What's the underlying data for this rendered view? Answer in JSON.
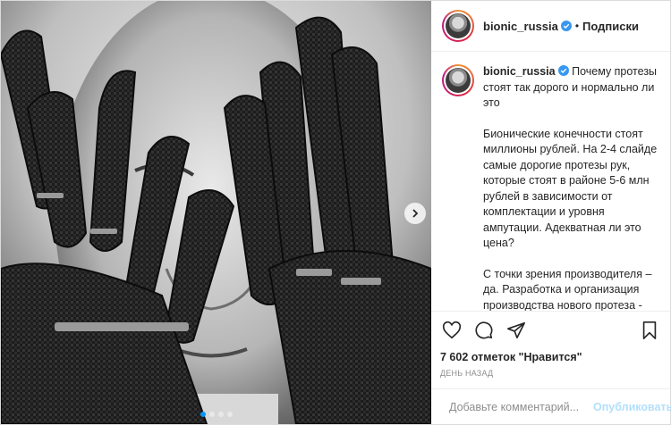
{
  "account": {
    "username": "bionic_russia",
    "verified": true,
    "follow_status": "Подписки",
    "separator": "•"
  },
  "media": {
    "slide_count": 4,
    "active_slide": 1
  },
  "caption": {
    "username": "bionic_russia",
    "paragraphs": [
      "Почему протезы стоят так дорого и нормально ли это",
      "Бионические конечности стоят миллионы рублей. На 2-4 слайде самые дорогие протезы рук, которые стоят в районе 5-6 млн рублей в зависимости от комплектации и уровня ампутации. Адекватная ли это цена?",
      "С точки зрения производителя – да. Разработка и организация производства нового протеза - это очень ресурсозатратное дело. Протезы изготавливают небольшими партиями, т.к. в мире немного людей с ампутированными руками. Из-за"
    ]
  },
  "stats": {
    "likes": "7 602 отметок \"Нравится\"",
    "time_ago": "день назад"
  },
  "comment": {
    "placeholder": "Добавьте комментарий...",
    "post_label": "Опубликовать"
  },
  "colors": {
    "accent": "#0095f6",
    "verified": "#3897f0",
    "post_disabled": "#b2dffc"
  }
}
